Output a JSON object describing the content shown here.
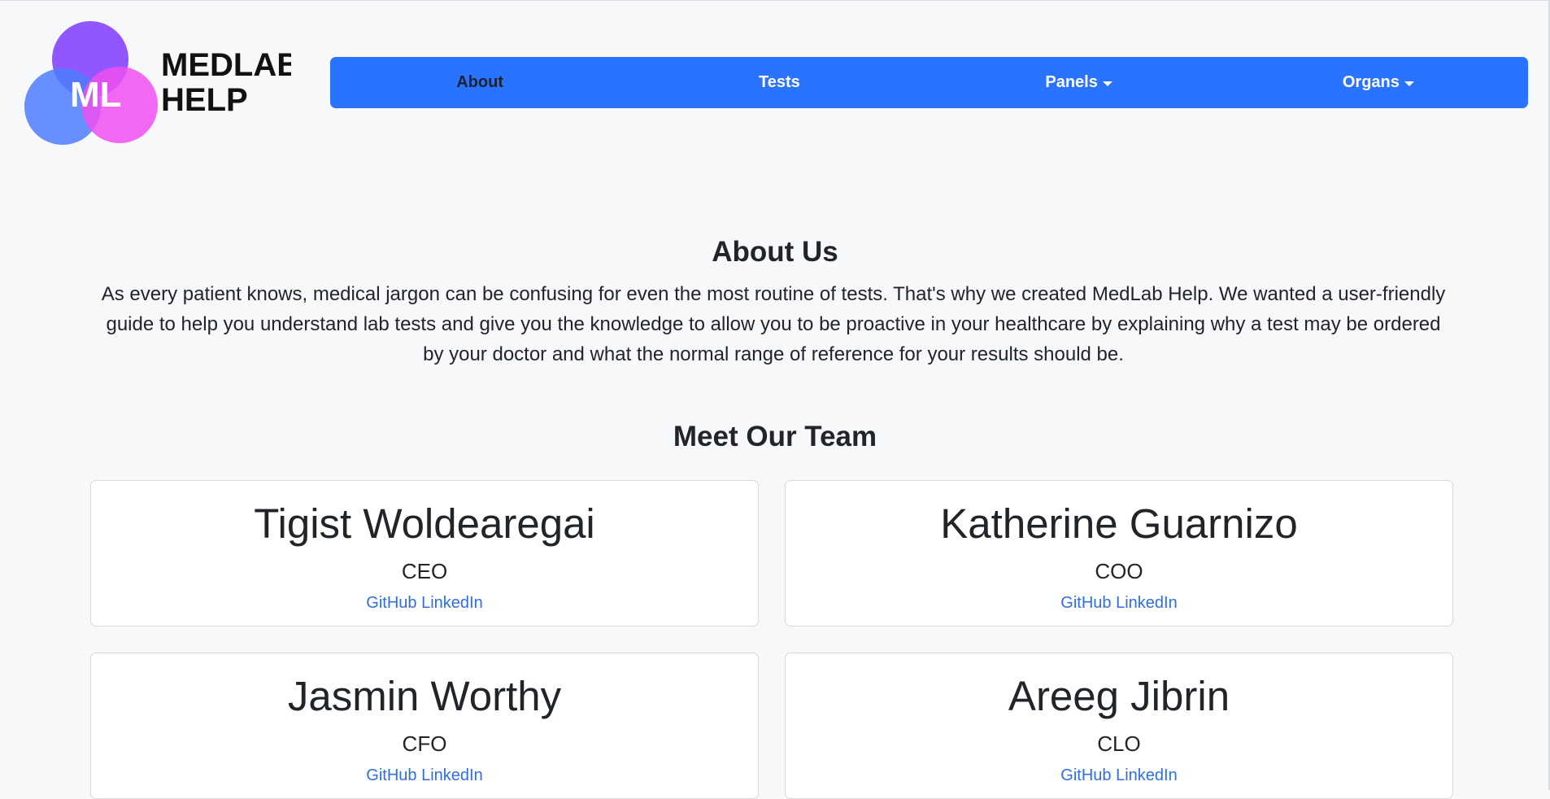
{
  "logo": {
    "line1": "MEDLAB",
    "line2": "HELP",
    "monogram": "ML",
    "colors": {
      "purple": "#8a4dff",
      "blue": "#4d7cff",
      "pink": "#f050f0"
    }
  },
  "nav": {
    "items": [
      {
        "label": "About",
        "active": true,
        "dropdown": false
      },
      {
        "label": "Tests",
        "active": false,
        "dropdown": false
      },
      {
        "label": "Panels",
        "active": false,
        "dropdown": true
      },
      {
        "label": "Organs",
        "active": false,
        "dropdown": true
      }
    ],
    "background": "#2a73ff"
  },
  "about": {
    "title": "About Us",
    "text": "As every patient knows, medical jargon can be confusing for even the most routine of tests. That's why we created MedLab Help. We wanted a user-friendly guide to help you understand lab tests and give you the knowledge to allow you to be proactive in your healthcare by explaining why a test may be ordered by your doctor and what the normal range of reference for your results should be."
  },
  "team": {
    "title": "Meet Our Team",
    "members": [
      {
        "name": "Tigist Woldearegai",
        "role": "CEO",
        "github": "GitHub",
        "linkedin": "LinkedIn"
      },
      {
        "name": "Katherine Guarnizo",
        "role": "COO",
        "github": "GitHub",
        "linkedin": "LinkedIn"
      },
      {
        "name": "Jasmin Worthy",
        "role": "CFO",
        "github": "GitHub",
        "linkedin": "LinkedIn"
      },
      {
        "name": "Areeg Jibrin",
        "role": "CLO",
        "github": "GitHub",
        "linkedin": "LinkedIn"
      }
    ]
  },
  "colors": {
    "page_bg": "#f7f8fa",
    "link": "#2f6fe0",
    "text": "#212529"
  }
}
